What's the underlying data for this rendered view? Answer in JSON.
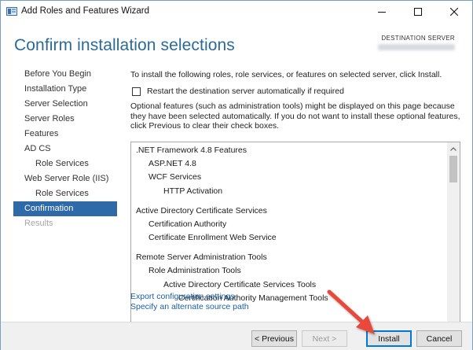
{
  "window": {
    "title": "Add Roles and Features Wizard",
    "icon": "server-manager-icon",
    "controls": [
      "minimize-icon",
      "maximize-icon",
      "close-icon"
    ]
  },
  "header": {
    "page_title": "Confirm installation selections",
    "destination_label": "DESTINATION SERVER"
  },
  "sidebar": {
    "items": [
      {
        "label": "Before You Begin",
        "state": "normal"
      },
      {
        "label": "Installation Type",
        "state": "normal"
      },
      {
        "label": "Server Selection",
        "state": "normal"
      },
      {
        "label": "Server Roles",
        "state": "normal"
      },
      {
        "label": "Features",
        "state": "normal"
      },
      {
        "label": "AD CS",
        "state": "normal"
      },
      {
        "label": "Role Services",
        "state": "sub"
      },
      {
        "label": "Web Server Role (IIS)",
        "state": "normal"
      },
      {
        "label": "Role Services",
        "state": "sub"
      },
      {
        "label": "Confirmation",
        "state": "active"
      },
      {
        "label": "Results",
        "state": "disabled"
      }
    ]
  },
  "content": {
    "intro": "To install the following roles, role services, or features on selected server, click Install.",
    "restart_label": "Restart the destination server automatically if required",
    "restart_checked": false,
    "optional_note": "Optional features (such as administration tools) might be displayed on this page because they have been selected automatically. If you do not want to install these optional features, click Previous to clear their check boxes.",
    "features": [
      {
        "label": ".NET Framework 4.8 Features",
        "level": 0
      },
      {
        "label": "ASP.NET 4.8",
        "level": 1
      },
      {
        "label": "WCF Services",
        "level": 1
      },
      {
        "label": "HTTP Activation",
        "level": 2
      },
      {
        "label": "Active Directory Certificate Services",
        "level": 0
      },
      {
        "label": "Certification Authority",
        "level": 1
      },
      {
        "label": "Certificate Enrollment Web Service",
        "level": 1
      },
      {
        "label": "Remote Server Administration Tools",
        "level": 0
      },
      {
        "label": "Role Administration Tools",
        "level": 1
      },
      {
        "label": "Active Directory Certificate Services Tools",
        "level": 2
      },
      {
        "label": "Certification Authority Management Tools",
        "level": 3
      }
    ]
  },
  "links": {
    "export": "Export configuration settings",
    "alternate_source": "Specify an alternate source path"
  },
  "buttons": {
    "previous": "< Previous",
    "next": "Next >",
    "install": "Install",
    "cancel": "Cancel"
  },
  "colors": {
    "title_blue": "#2a6a99",
    "active_nav": "#2f6aa8",
    "link": "#1a5fa6",
    "annotation_arrow": "#e8483a"
  }
}
